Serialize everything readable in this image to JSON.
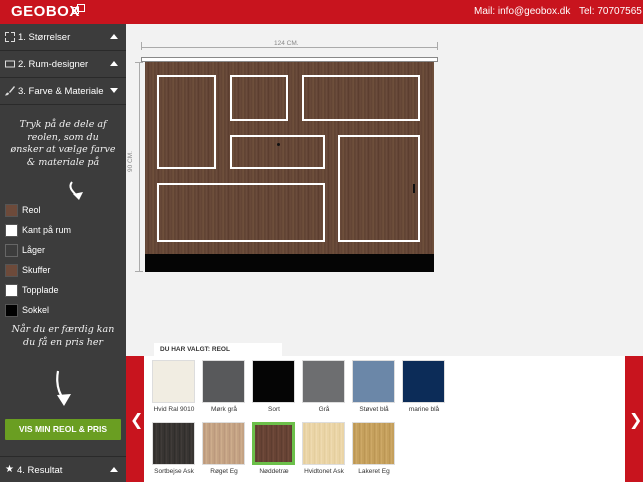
{
  "header": {
    "logo": "GEOBOX",
    "mail": "Mail: info@geobox.dk",
    "tel": "Tel: 70707565"
  },
  "sidebar": {
    "menu": [
      {
        "label": "1. Størrelser",
        "icon": "resize-icon"
      },
      {
        "label": "2. Rum-designer",
        "icon": "rectangle-icon"
      },
      {
        "label": "3. Farve & Materiale",
        "icon": "brush-icon"
      }
    ],
    "instruction1": "Tryk på de dele af reolen, som du ønsker at vælge farve & materiale på",
    "parts": [
      {
        "label": "Reol",
        "color": "#6d4a3a"
      },
      {
        "label": "Kant på rum",
        "color": "#ffffff"
      },
      {
        "label": "Låger",
        "color": "#3c3c3c"
      },
      {
        "label": "Skuffer",
        "color": "#6d4a3a"
      },
      {
        "label": "Topplade",
        "color": "#ffffff"
      },
      {
        "label": "Sokkel",
        "color": "#000000"
      }
    ],
    "instruction2": "Når du er færdig kan du få en pris her",
    "cta": "VIS MIN REOL & PRIS",
    "result": "4. Resultat"
  },
  "canvas": {
    "width_label": "124 CM.",
    "height_label": "90 CM."
  },
  "materials": {
    "chosen": "DU HAR VALGT: REOL",
    "row1": [
      {
        "label": "Hvid Ral 9010",
        "color": "#f1ede2"
      },
      {
        "label": "Mørk grå",
        "color": "#58595b"
      },
      {
        "label": "Sort",
        "color": "#050505"
      },
      {
        "label": "Grå",
        "color": "#6d6e70"
      },
      {
        "label": "Støvet blå",
        "color": "#6b87a8"
      },
      {
        "label": "marine blå",
        "color": "#0c2c58"
      }
    ],
    "row2": [
      {
        "label": "Sortbejse Ask",
        "color": "#3b3836"
      },
      {
        "label": "Røget Eg",
        "color": "#c7a585"
      },
      {
        "label": "Nøddetræ",
        "color": "#6b4536",
        "selected": true
      },
      {
        "label": "Hvidtonet Ask",
        "color": "#ecd7a9"
      },
      {
        "label": "Lakeret Eg",
        "color": "#c9a461"
      }
    ]
  }
}
